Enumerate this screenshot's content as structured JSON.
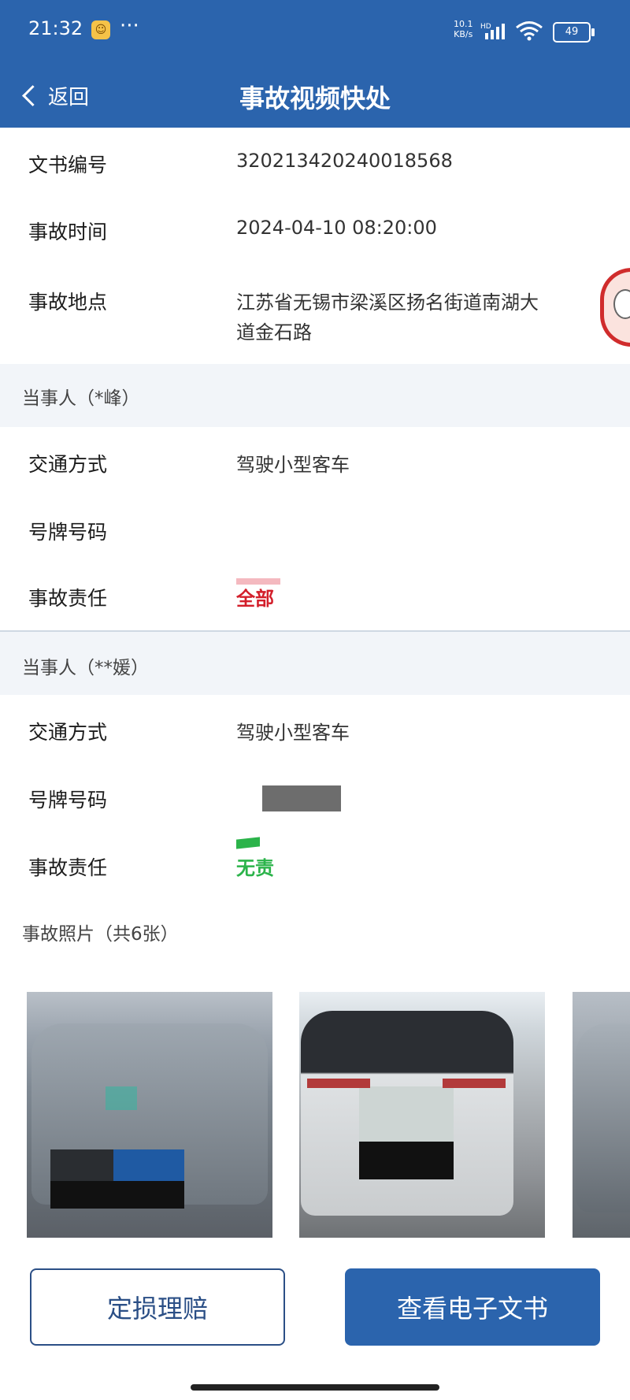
{
  "status_bar": {
    "time": "21:32",
    "more": "···",
    "net_speed_value": "10.1",
    "net_speed_unit": "KB/s",
    "network": "HD",
    "battery": "49",
    "icons": [
      "app-notification-icon",
      "signal-icon",
      "wifi-icon",
      "battery-icon"
    ]
  },
  "nav": {
    "back_label": "返回",
    "title": "事故视频快处"
  },
  "info": {
    "doc_no_label": "文书编号",
    "doc_no_value": "32021342024001856​8",
    "time_label": "事故时间",
    "time_value": "2024-04-10 08:20:00",
    "place_label": "事故地点",
    "place_value_line1": "江苏省无锡市梁溪区扬名街道南湖大",
    "place_value_line2": "道金石路"
  },
  "parties": [
    {
      "title": "当事人（*峰）",
      "mode_label": "交通方式",
      "mode_value": "驾驶小型客车",
      "plate_label": "号牌号码",
      "plate_value": "",
      "liability_label": "事故责任",
      "liability_value": "全部",
      "liability_color": "#d31f2b"
    },
    {
      "title": "当事人（**媛）",
      "mode_label": "交通方式",
      "mode_value": "驾驶小型客车",
      "plate_label": "号牌号码",
      "plate_value": "",
      "liability_label": "事故责任",
      "liability_value": "无责",
      "liability_color": "#2bb34a"
    }
  ],
  "photos": {
    "title": "事故照片（共6张）",
    "count": 6
  },
  "buttons": {
    "claim": "定损理赔",
    "view_doc": "查看电子文书"
  },
  "colors": {
    "brand": "#2b64ad",
    "section_bg": "#f2f5f9"
  }
}
